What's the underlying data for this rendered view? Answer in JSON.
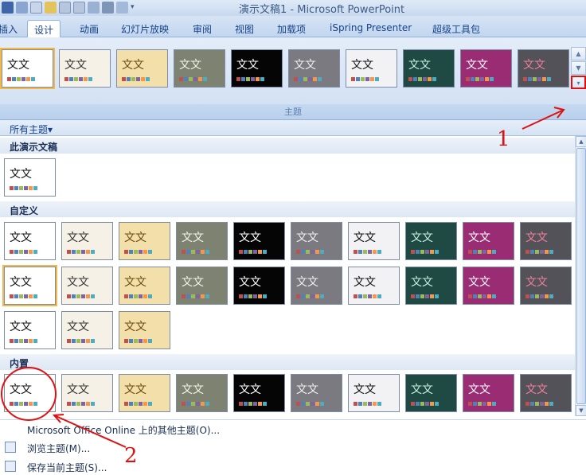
{
  "window": {
    "title": "演示文稿1 - Microsoft PowerPoint"
  },
  "tabs": [
    {
      "label": "插入"
    },
    {
      "label": "设计"
    },
    {
      "label": "动画"
    },
    {
      "label": "幻灯片放映"
    },
    {
      "label": "审阅"
    },
    {
      "label": "视图"
    },
    {
      "label": "加载项"
    },
    {
      "label": "iSpring Presenter"
    },
    {
      "label": "超级工具包"
    }
  ],
  "ribbon": {
    "group_label": "主题",
    "sample_text": "文文",
    "more_icon": "dropdown-more-icon"
  },
  "panel": {
    "all_themes_label": "所有主题▾",
    "sections": [
      {
        "title": "此演示文稿"
      },
      {
        "title": "自定义"
      },
      {
        "title": "内置"
      }
    ],
    "thumb_text": "文文"
  },
  "menu": [
    {
      "label": "Microsoft Office Online 上的其他主题(O)...",
      "icon": "none"
    },
    {
      "label": "浏览主题(M)...",
      "icon": "browse-folder-icon"
    },
    {
      "label": "保存当前主题(S)...",
      "icon": "save-theme-icon"
    }
  ],
  "annotations": {
    "one": "1",
    "two": "2",
    "color": "#e01010"
  },
  "themes": [
    {
      "bg": "#ffffff",
      "fg": "#111111"
    },
    {
      "bg": "#f6f1e6",
      "fg": "#333333"
    },
    {
      "bg": "#f3dfaa",
      "fg": "#6a4b12"
    },
    {
      "bg": "#7d8370",
      "fg": "#f4f4e8"
    },
    {
      "bg": "#050505",
      "fg": "#ffffff"
    },
    {
      "bg": "#7a7a80",
      "fg": "#f0f0f0"
    },
    {
      "bg": "#f2f2f5",
      "fg": "#111111"
    },
    {
      "bg": "#1f4a44",
      "fg": "#c9f0e0"
    },
    {
      "bg": "#9a2c74",
      "fg": "#ffffff"
    },
    {
      "bg": "#525258",
      "fg": "#f07f9a"
    }
  ]
}
